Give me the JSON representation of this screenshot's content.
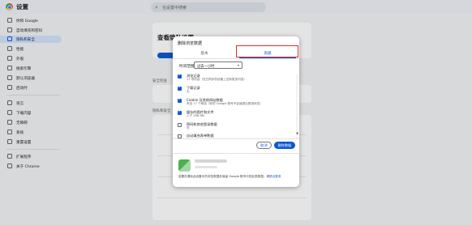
{
  "app": {
    "title": "设置"
  },
  "search": {
    "placeholder": "在设置中搜索"
  },
  "sidebar": {
    "items": [
      {
        "label": "你和 Google",
        "icon": "person-icon"
      },
      {
        "label": "自动填充和密码",
        "icon": "autofill-icon"
      },
      {
        "label": "隐私和安全",
        "icon": "shield-icon",
        "active": true
      },
      {
        "label": "性能",
        "icon": "speedometer-icon"
      },
      {
        "label": "外观",
        "icon": "palette-icon"
      },
      {
        "label": "搜索引擎",
        "icon": "search-icon"
      },
      {
        "label": "默认浏览器",
        "icon": "browser-icon"
      },
      {
        "label": "启动时",
        "icon": "power-icon"
      },
      {
        "label": "语言",
        "icon": "language-icon"
      },
      {
        "label": "下载内容",
        "icon": "download-icon"
      },
      {
        "label": "无障碍",
        "icon": "accessibility-icon"
      },
      {
        "label": "系统",
        "icon": "wrench-icon"
      },
      {
        "label": "重置设置",
        "icon": "reset-icon"
      },
      {
        "label": "扩展程序",
        "icon": "puzzle-icon"
      },
      {
        "label": "关于 Chrome",
        "icon": "chrome-icon"
      }
    ]
  },
  "main": {
    "hero_title": "查看隐私设置",
    "safety_check_label": "安全检查",
    "privacy_label": "隐私和安全"
  },
  "dialog": {
    "title": "删除浏览数据",
    "tabs": [
      {
        "label": "基本"
      },
      {
        "label": "高级",
        "selected": true
      }
    ],
    "time_range_label": "时间范围",
    "time_range_value": "过去一小时",
    "options": [
      {
        "title": "浏览记录",
        "desc": "17 项内容（在已同步的设备上还有更多内容）",
        "checked": true
      },
      {
        "title": "下载记录",
        "desc": "无",
        "checked": true
      },
      {
        "title": "Cookie 及其他网站数据",
        "desc": "来自 17 个网站（你的 Google 账号不会被退出登录状态）",
        "checked": true
      },
      {
        "title": "缓存的图片和文件",
        "desc": "少于 298 MB",
        "checked": true
      },
      {
        "title": "密码和其他登录数据",
        "desc": "无",
        "checked": false
      },
      {
        "title": "自动填充表单数据",
        "desc": "",
        "checked": false
      }
    ],
    "cancel_label": "取消",
    "delete_label": "删除数据",
    "footer_text": "若要仅清除此设备中的浏览数据并保留 Google 账号中的此类数据，请",
    "footer_link": "退出登录"
  },
  "colors": {
    "accent": "#0b57d0",
    "highlight_box": "#d93025"
  }
}
